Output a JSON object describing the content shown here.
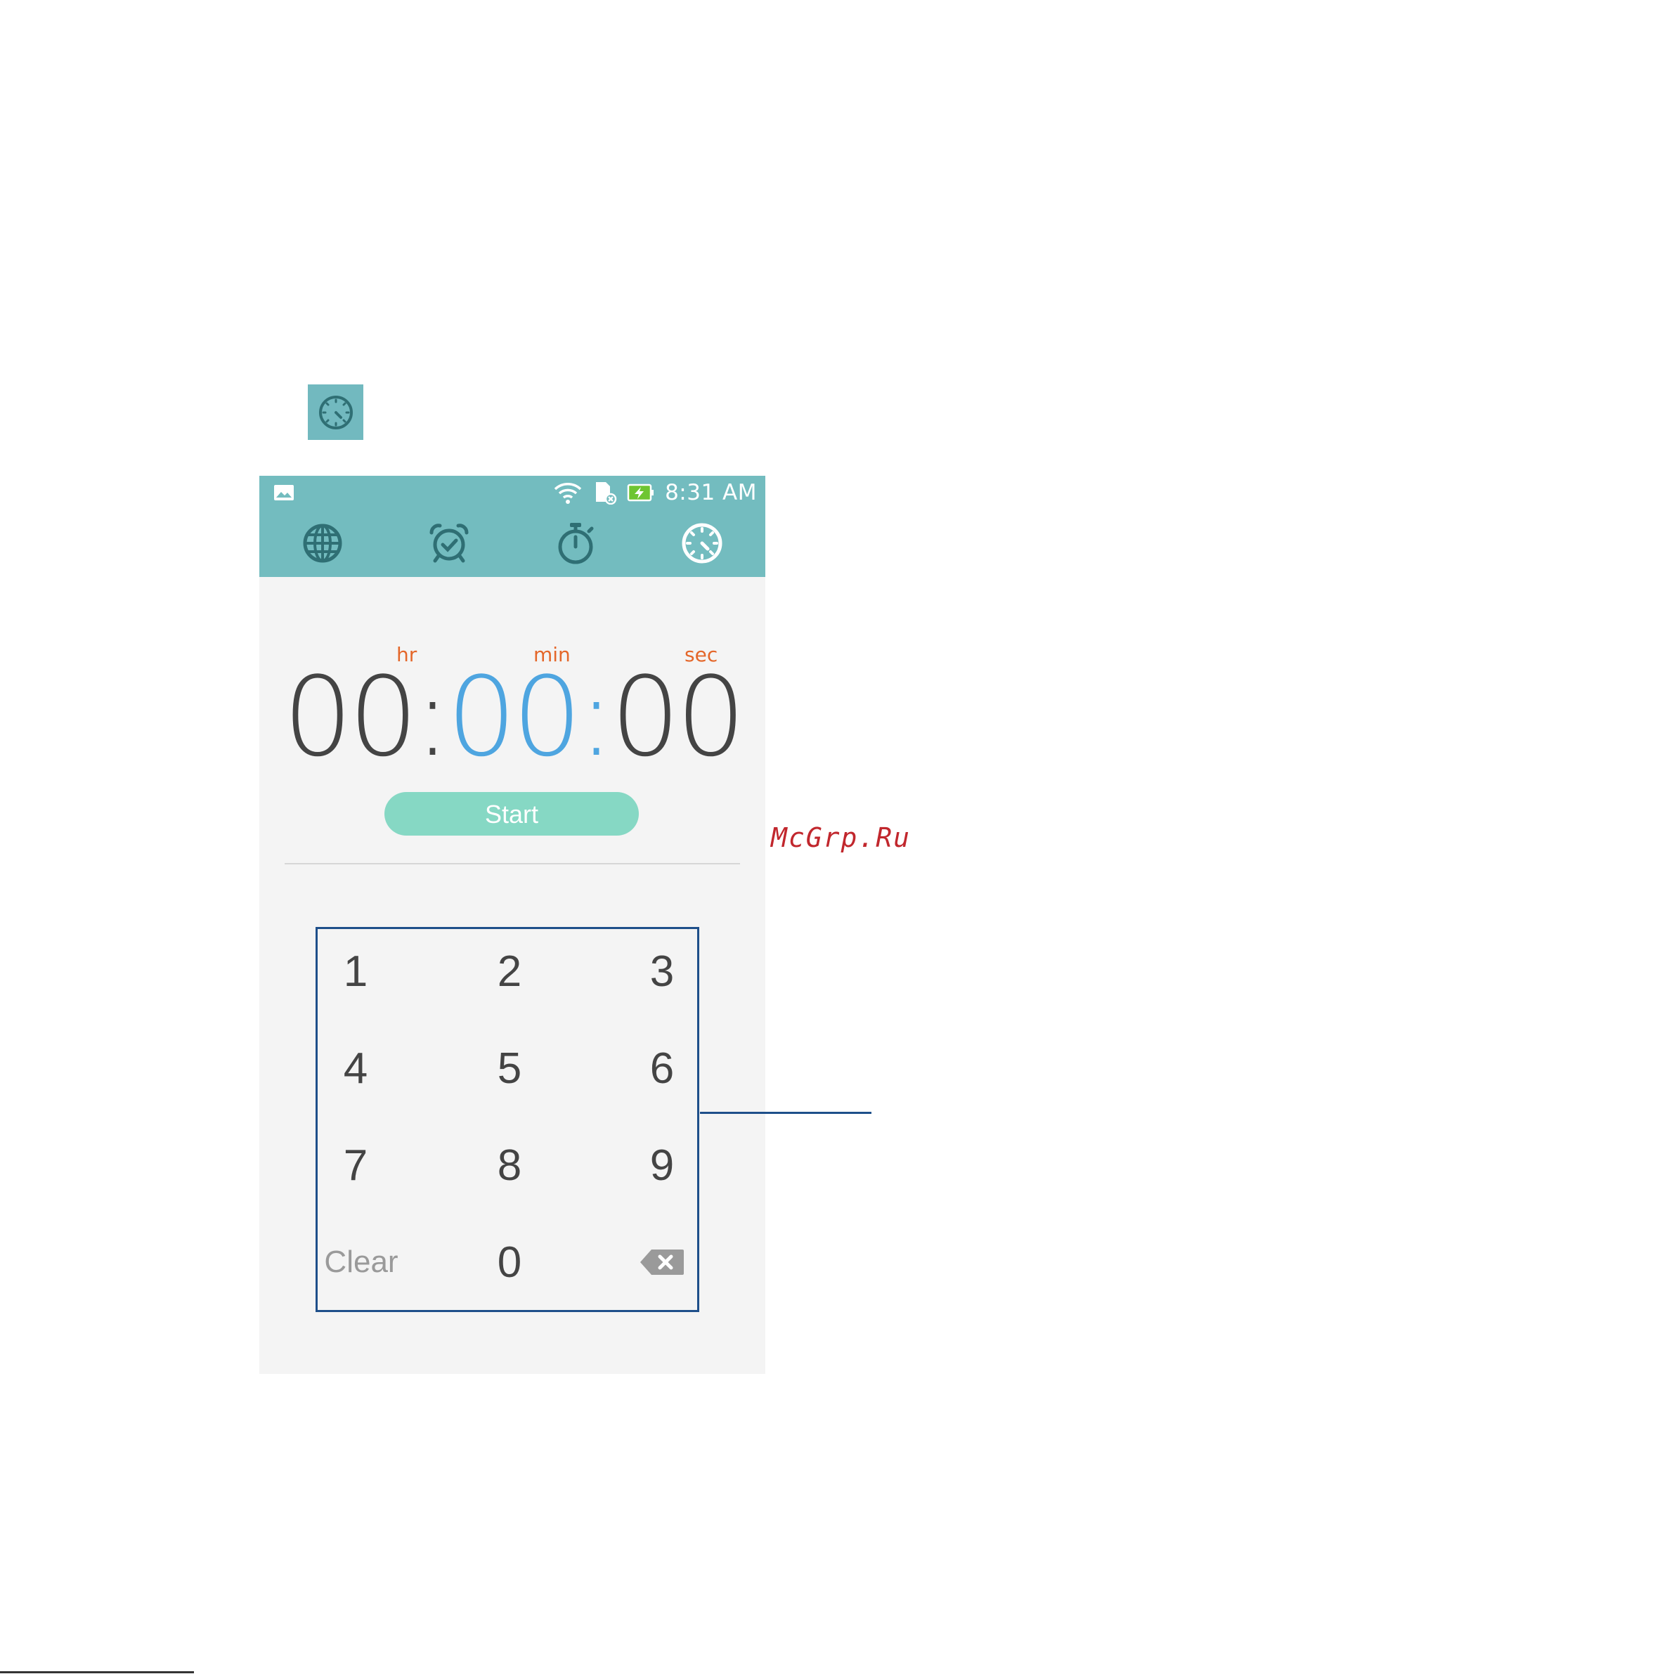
{
  "status_bar": {
    "time": "8:31 AM"
  },
  "tabs": [
    {
      "name": "world-clock",
      "icon": "globe-icon"
    },
    {
      "name": "alarm",
      "icon": "alarm-clock-icon"
    },
    {
      "name": "stopwatch",
      "icon": "stopwatch-icon"
    },
    {
      "name": "timer",
      "icon": "timer-icon",
      "active": true
    }
  ],
  "timer": {
    "labels": {
      "hr": "hr",
      "min": "min",
      "sec": "sec"
    },
    "hours": "00",
    "separator1": ":",
    "minutes": "00",
    "separator2": ":",
    "seconds": "00",
    "start_label": "Start"
  },
  "keypad": {
    "keys": [
      "1",
      "2",
      "3",
      "4",
      "5",
      "6",
      "7",
      "8",
      "9",
      "Clear",
      "0"
    ],
    "backspace_icon": "backspace-icon"
  },
  "watermark": "McGrp.Ru",
  "colors": {
    "accent": "#73bcbf",
    "active_digits": "#4ea5e0",
    "labels": "#e4672a",
    "start_button": "#86d8c4",
    "callout": "#1e4f8a"
  }
}
